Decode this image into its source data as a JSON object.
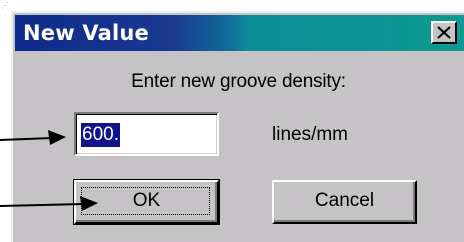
{
  "dialog": {
    "title": "New Value",
    "close_icon": "close-icon",
    "prompt": "Enter new groove density:",
    "input": {
      "value": "600.",
      "units": "lines/mm"
    },
    "buttons": {
      "ok_label": "OK",
      "cancel_label": "Cancel"
    }
  },
  "colors": {
    "title_start": "#0d2a8a",
    "title_end": "#0c9a92",
    "dialog_face": "#c6c3c6",
    "selection": "#10148c"
  },
  "annotations": {
    "arrow_icon": "arrow-right-icon"
  }
}
